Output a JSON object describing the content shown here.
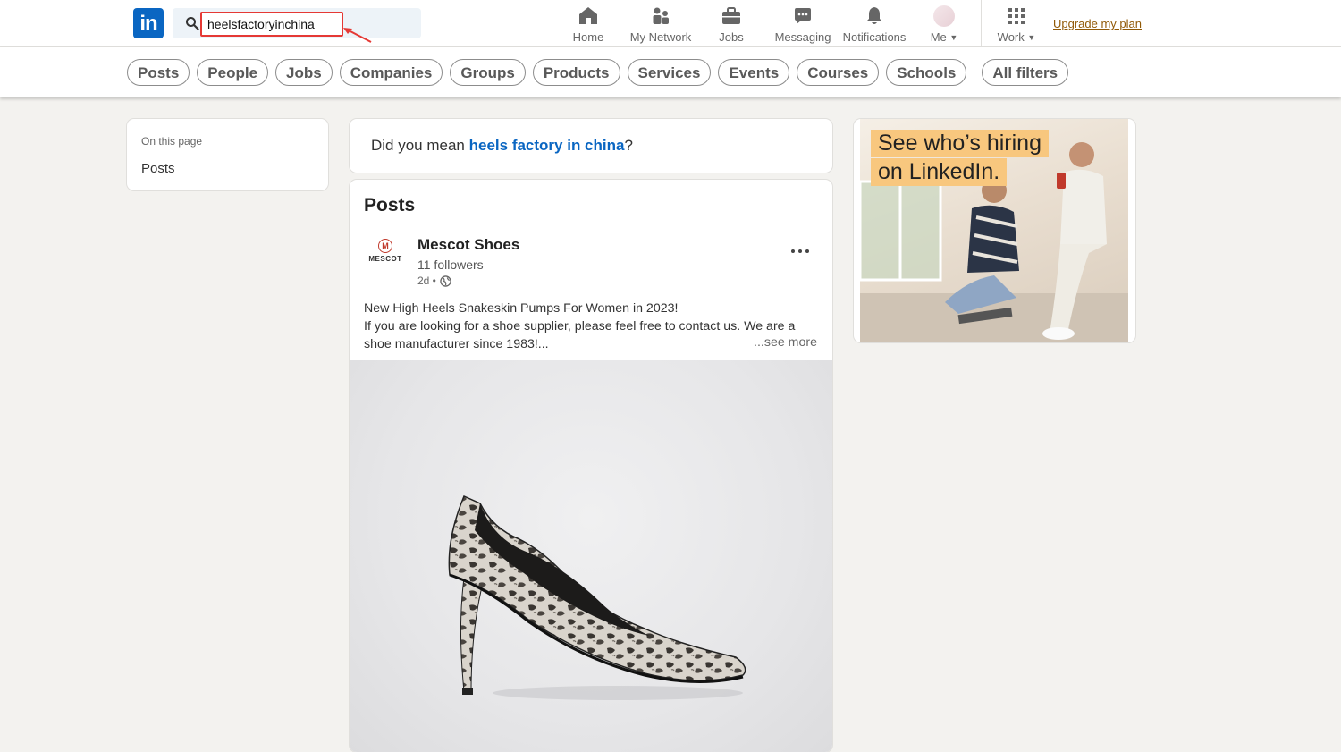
{
  "nav": {
    "logo_text": "in",
    "search_value": "heelsfactoryinchina",
    "items": [
      {
        "label": "Home",
        "icon": "home-icon"
      },
      {
        "label": "My Network",
        "icon": "network-icon"
      },
      {
        "label": "Jobs",
        "icon": "briefcase-icon"
      },
      {
        "label": "Messaging",
        "icon": "messaging-icon"
      },
      {
        "label": "Notifications",
        "icon": "bell-icon"
      },
      {
        "label": "Me",
        "icon": "avatar"
      },
      {
        "label": "Work",
        "icon": "grid-icon"
      }
    ],
    "upgrade_label": "Upgrade my plan"
  },
  "filters": [
    "Posts",
    "People",
    "Jobs",
    "Companies",
    "Groups",
    "Products",
    "Services",
    "Events",
    "Courses",
    "Schools"
  ],
  "all_filters_label": "All filters",
  "on_this_page": {
    "title": "On this page",
    "link": "Posts"
  },
  "did_you_mean": {
    "prefix": "Did you mean ",
    "suggestion": "heels factory in china",
    "suffix": "?"
  },
  "posts": {
    "heading": "Posts",
    "post": {
      "author": "Mescot Shoes",
      "logo_letter": "M",
      "logo_word": "MESCOT",
      "followers": "11 followers",
      "age": "2d •",
      "line1": "New High Heels Snakeskin Pumps For Women in 2023!",
      "line2": "If you are looking for a shoe supplier, please feel free to contact us. We are a shoe manufacturer since 1983!...",
      "see_more": "...see more"
    }
  },
  "ad": {
    "line1": "See who’s hiring",
    "line2": "on LinkedIn."
  },
  "colors": {
    "brand": "#0a66c2",
    "upgrade": "#915907",
    "annotation": "#e53935",
    "ad_highlight": "#f8c77e"
  }
}
